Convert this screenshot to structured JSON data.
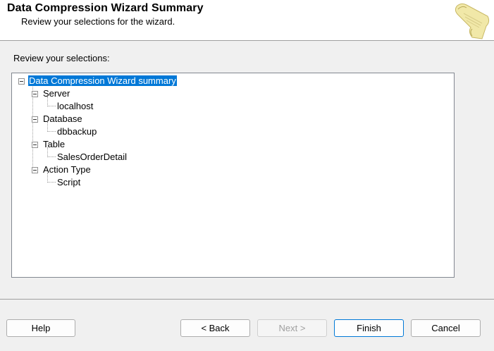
{
  "header": {
    "title": "Data Compression Wizard Summary",
    "subtitle": "Review your selections for the wizard.",
    "icon": "scroll-icon"
  },
  "main": {
    "section_label": "Review your selections:",
    "tree": {
      "root": "Data Compression Wizard summary",
      "items": [
        {
          "label": "Server",
          "child": "localhost"
        },
        {
          "label": "Database",
          "child": "dbbackup"
        },
        {
          "label": "Table",
          "child": "SalesOrderDetail"
        },
        {
          "label": "Action Type",
          "child": "Script"
        }
      ]
    }
  },
  "footer": {
    "help": "Help",
    "back": "< Back",
    "next": "Next >",
    "finish": "Finish",
    "cancel": "Cancel"
  },
  "colors": {
    "selection": "#0078d7",
    "default_button_border": "#0078d7"
  }
}
